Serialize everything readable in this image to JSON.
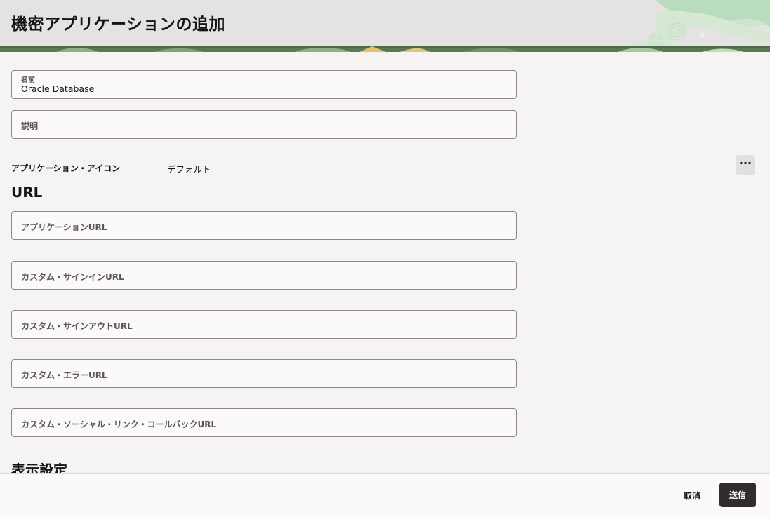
{
  "header": {
    "title": "機密アプリケーションの追加"
  },
  "form": {
    "name": {
      "label": "名前",
      "value": "Oracle Database"
    },
    "description": {
      "label": "説明"
    },
    "app_icon": {
      "label": "アプリケーション・アイコン",
      "value": "デフォルト",
      "more": "···"
    }
  },
  "url_section": {
    "title": "URL",
    "fields": [
      {
        "label": "アプリケーションURL"
      },
      {
        "label": "カスタム・サインインURL"
      },
      {
        "label": "カスタム・サインアウトURL"
      },
      {
        "label": "カスタム・エラーURL"
      },
      {
        "label": "カスタム・ソーシャル・リンク・コールバックURL"
      }
    ]
  },
  "display_section": {
    "title": "表示設定"
  },
  "footer": {
    "cancel_label": "取消",
    "submit_label": "送信"
  },
  "colors": {
    "header_bg": "#e4e3e1",
    "page_bg": "#f5f4f2",
    "primary_button": "#312d2a"
  }
}
